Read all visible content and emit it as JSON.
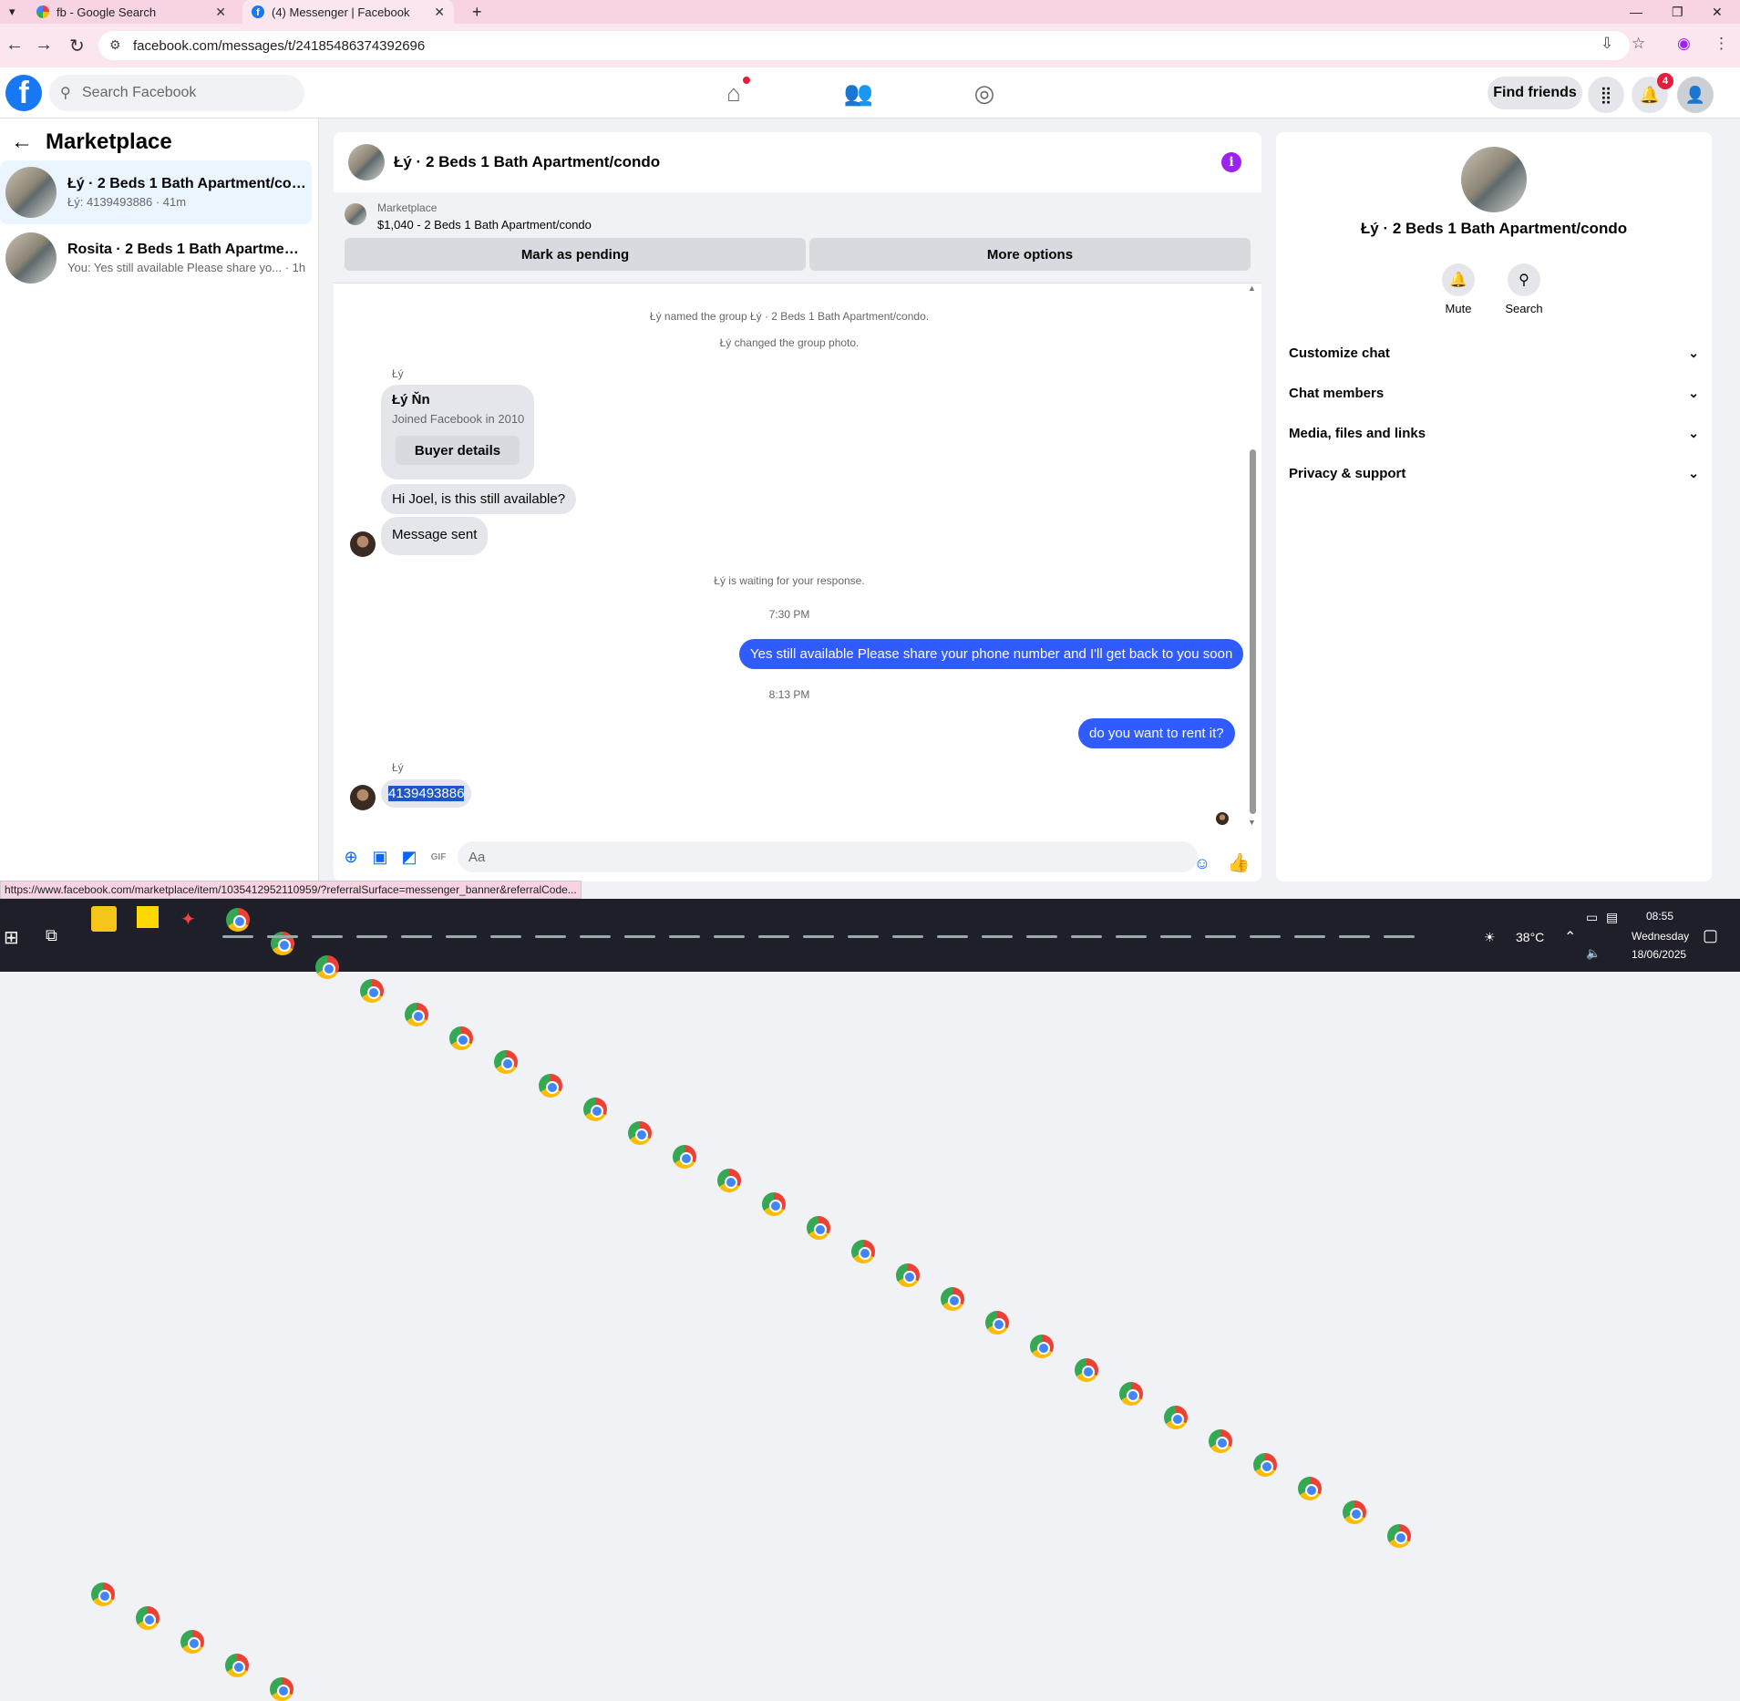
{
  "browser": {
    "tabs": [
      {
        "title": "fb - Google Search",
        "close": "✕"
      },
      {
        "title": "(4) Messenger | Facebook",
        "close": "✕"
      }
    ],
    "new_tab": "+",
    "url": "facebook.com/messages/t/24185486374392696",
    "status_url": "https://www.facebook.com/marketplace/item/1035412952110959/?referralSurface=messenger_banner&referralCode..."
  },
  "fb_header": {
    "search_placeholder": "Search Facebook",
    "find_friends": "Find friends",
    "notification_count": "4"
  },
  "left": {
    "title": "Marketplace",
    "conversations": [
      {
        "name": "Łý · 2 Beds 1 Bath Apartment/condo",
        "preview": "Łý: 4139493886 · 41m"
      },
      {
        "name": "Rosita · 2 Beds 1 Bath Apartment/c...",
        "preview": "You: Yes still available Please share yo...  · 1h"
      }
    ]
  },
  "chat": {
    "title": "Łý · 2 Beds 1 Bath Apartment/condo",
    "banner_label": "Marketplace",
    "banner_listing": "$1,040 - 2 Beds 1 Bath Apartment/condo",
    "mark_pending": "Mark as pending",
    "more_options": "More options",
    "sys_named": "Łý named the group Łý · 2 Beds 1 Bath Apartment/condo.",
    "sys_photo": "Łý changed the group photo.",
    "sender1": "Łý",
    "card_name": "Łý Ňn",
    "card_sub": "Joined Facebook in 2010",
    "card_button": "Buyer details",
    "msg1": "Hi Joel, is this still available?",
    "msg2": "Message sent",
    "sys_waiting": "Łý is waiting for your response.",
    "time1": "7:30 PM",
    "out1": "Yes still available Please share your phone number and I'll get back to you soon",
    "time2": "8:13 PM",
    "out2": "do you want to rent it?",
    "sender2": "Łý",
    "msg3": "4139493886",
    "input_placeholder": "Aa"
  },
  "right": {
    "title": "Łý · 2 Beds 1 Bath Apartment/condo",
    "mute": "Mute",
    "search": "Search",
    "sections": [
      "Customize chat",
      "Chat members",
      "Media, files and links",
      "Privacy & support"
    ]
  },
  "taskbar": {
    "weather": "38°C",
    "time": "08:55",
    "day": "Wednesday",
    "date": "18/06/2025"
  }
}
